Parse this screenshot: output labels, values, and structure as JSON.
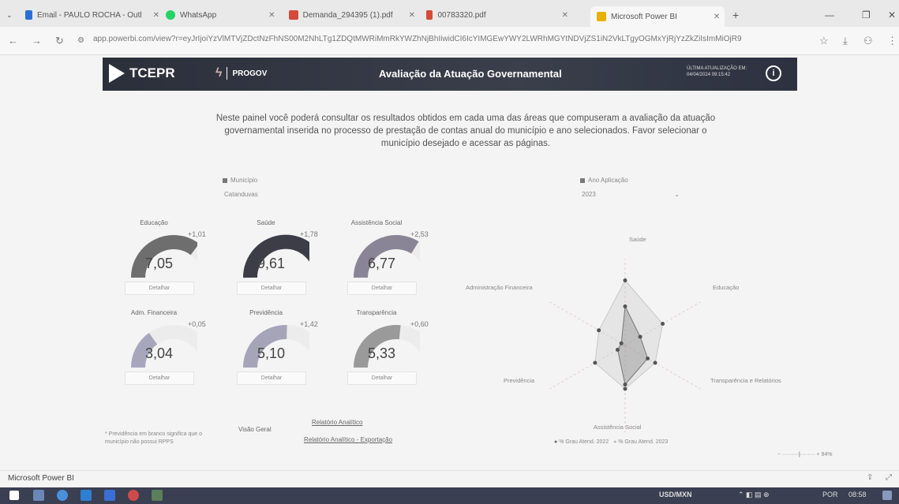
{
  "browser": {
    "tabs": [
      {
        "label": "Email - PAULO ROCHA - Outl",
        "color": "#2a6fd6"
      },
      {
        "label": "WhatsApp",
        "color": "#25d366"
      },
      {
        "label": "Demanda_294395 (1).pdf",
        "color": "#d64a3a"
      },
      {
        "label": "00783320.pdf",
        "color": "#d64a3a"
      },
      {
        "label": "Microsoft Power BI",
        "color": "#e8b100"
      }
    ],
    "url": "app.powerbi.com/view?r=eyJrIjoiYzVlMTVjZDctNzFhNS00M2NhLTg1ZDQtMWRiMmRkYWZhNjBhIiwidCI6IcYIMGEwYWY2LWRhMGYtNDVjZS1iN2VkLTgyOGMxYjRjYzZkZiIsImMiOjR9"
  },
  "header": {
    "brand": "TCEPR",
    "sub_brand": "PROGOV",
    "title": "Avaliação da Atuação Governamental",
    "date_line1": "ÚLTIMA ATUALIZAÇÃO EM:",
    "date_line2": "04/04/2024 09:15:42"
  },
  "intro": "Neste painel você poderá consultar os resultados obtidos em cada uma das áreas que compuseram a avaliação da atuação governamental inserida no processo de prestação de contas anual do município e ano selecionados. Favor selecionar o município desejado e acessar as páginas.",
  "slicers": {
    "municipio_label": "Município",
    "municipio_value": "Catanduvas",
    "ano_label": "Ano Aplicação",
    "ano_value": "2023"
  },
  "gauges": [
    {
      "title": "Educação",
      "value": "7,05",
      "delta": "+1,01",
      "level": 0.705,
      "color": "#6e6e6e",
      "button": "Detalhar"
    },
    {
      "title": "Saúde",
      "value": "9,61",
      "delta": "+1,78",
      "level": 0.961,
      "color": "#3d3d48",
      "button": "Detalhar"
    },
    {
      "title": "Assistência Social",
      "value": "6,77",
      "delta": "+2,53",
      "level": 0.677,
      "color": "#8a8596",
      "button": "Detalhar"
    },
    {
      "title": "Adm. Financeira",
      "value": "3,04",
      "delta": "+0,05",
      "level": 0.304,
      "color": "#a8a6bc",
      "button": "Detalhar"
    },
    {
      "title": "Previdência",
      "value": "5,10",
      "delta": "+1,42",
      "level": 0.51,
      "color": "#a6a4b8",
      "button": "Detalhar"
    },
    {
      "title": "Transparência",
      "value": "5,33",
      "delta": "+0,60",
      "level": 0.533,
      "color": "#9a9a9a",
      "button": "Detalhar"
    }
  ],
  "radar": {
    "axes": [
      "Saúde",
      "Educação",
      "Transparência e Relatórios",
      "Assistência Social",
      "Previdência",
      "Administração Financeira"
    ],
    "series": [
      {
        "name": "% Grau Atend. 2022",
        "values": [
          0.45,
          0.2,
          0.3,
          0.45,
          0.1,
          0.05
        ],
        "color": "#777777"
      },
      {
        "name": "% Grau Atend. 2023",
        "values": [
          0.75,
          0.5,
          0.4,
          0.5,
          0.4,
          0.35
        ],
        "color": "#c8c8c8"
      }
    ],
    "legend": "● % Grau Atend. 2022  ● % Grau Atend. 2023"
  },
  "footer": {
    "note": "* Previdência em branco significa que o município não possui RPPS",
    "visao_geral": "Visão Geral",
    "relatorio_analitico": "Relatório Analítico",
    "relatorio_export": "Relatório Analítico - Exportação",
    "zoom": "94%",
    "app_label": "Microsoft Power BI"
  },
  "taskbar": {
    "currency": "USD/MXN",
    "lang": "POR",
    "time": "08:58"
  }
}
